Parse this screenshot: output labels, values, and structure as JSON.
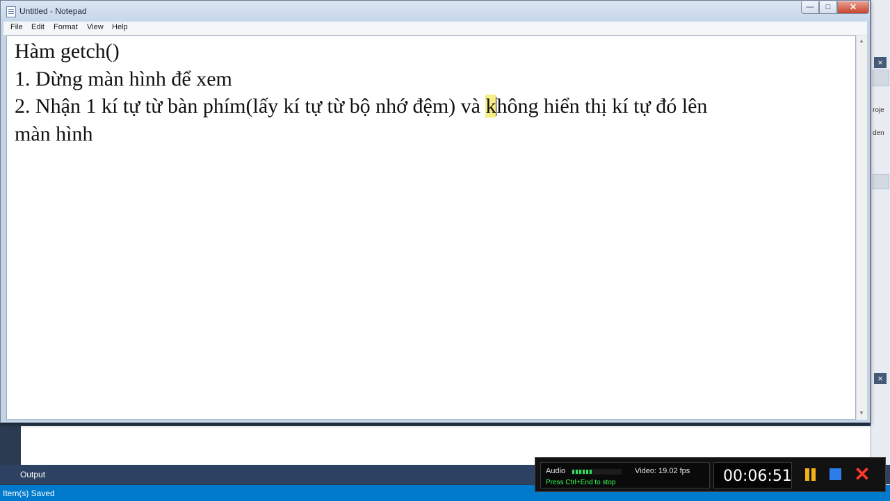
{
  "window": {
    "title": "Untitled - Notepad",
    "close_glyph": "✕",
    "minimize_glyph": "—",
    "maximize_glyph": "□"
  },
  "menu": {
    "file": "File",
    "edit": "Edit",
    "format": "Format",
    "view": "View",
    "help": "Help"
  },
  "document": {
    "line1": "Hàm getch()",
    "line2": "1. Dừng màn hình để xem",
    "line3_before_cursor": "2. Nhận 1 kí tự từ bàn phím(lấy kí tự từ bộ nhớ đệm) và ",
    "line3_highlight": "k",
    "line3_after_cursor": "hông hiển thị kí tự đó lên",
    "line4": "màn hình"
  },
  "ide": {
    "output_tab": "Output",
    "status": "Item(s) Saved",
    "side_text_1": "roje",
    "side_text_2": "den"
  },
  "recorder": {
    "audio_label": "Audio",
    "video_label": "Video: 19.02 fps",
    "hint": "Press Ctrl+End to stop",
    "timer": "00:06:51",
    "pause_icon": "pause-icon",
    "stop_icon": "stop-icon",
    "close_icon": "close-icon",
    "colors": {
      "pause": "#f3b21a",
      "stop": "#2b7de9",
      "close": "#ff3a2b",
      "meter": "#2ee35a"
    }
  }
}
